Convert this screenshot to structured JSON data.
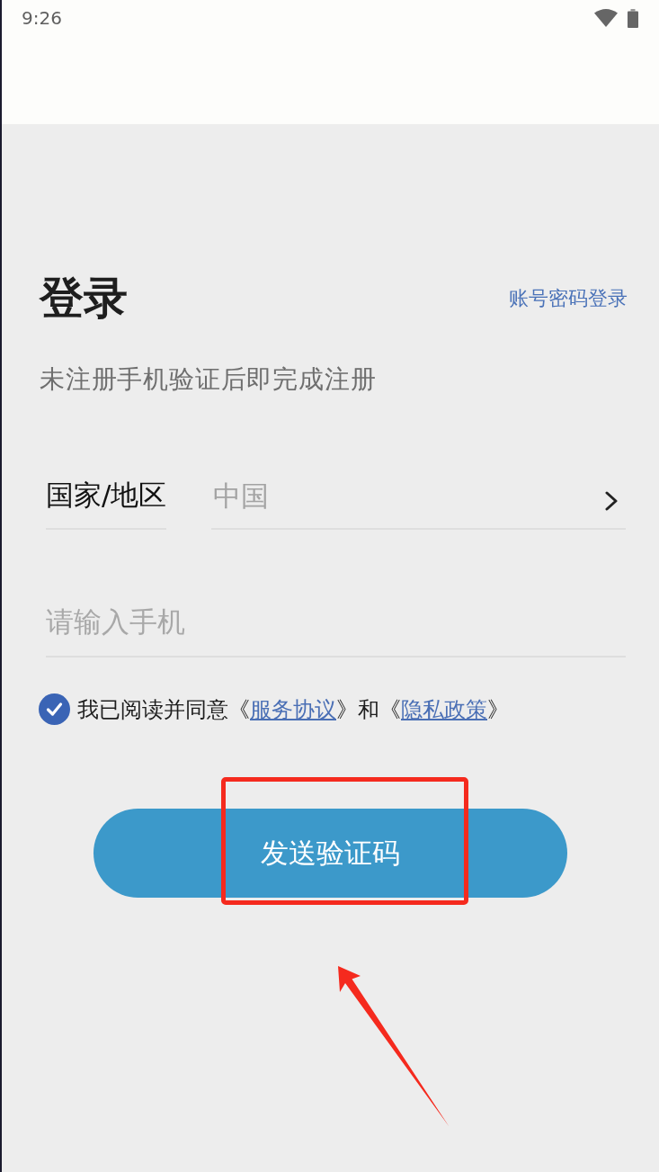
{
  "status_bar": {
    "time": "9:26"
  },
  "header": {
    "title": "登录",
    "alt_login_link": "账号密码登录",
    "subtitle": "未注册手机验证后即完成注册"
  },
  "region": {
    "label": "国家/地区",
    "value": "中国"
  },
  "phone": {
    "placeholder": "请输入手机"
  },
  "agreement": {
    "checked": true,
    "parts": [
      {
        "kind": "text",
        "text": "我已阅读并同意《"
      },
      {
        "kind": "link",
        "text": "服务协议"
      },
      {
        "kind": "text",
        "text": "》和《"
      },
      {
        "kind": "link",
        "text": "隐私政策"
      },
      {
        "kind": "text",
        "text": "》"
      }
    ]
  },
  "submit_button": {
    "label": "发送验证码"
  },
  "annotations": {
    "highlight_box": true,
    "arrow": true
  }
}
